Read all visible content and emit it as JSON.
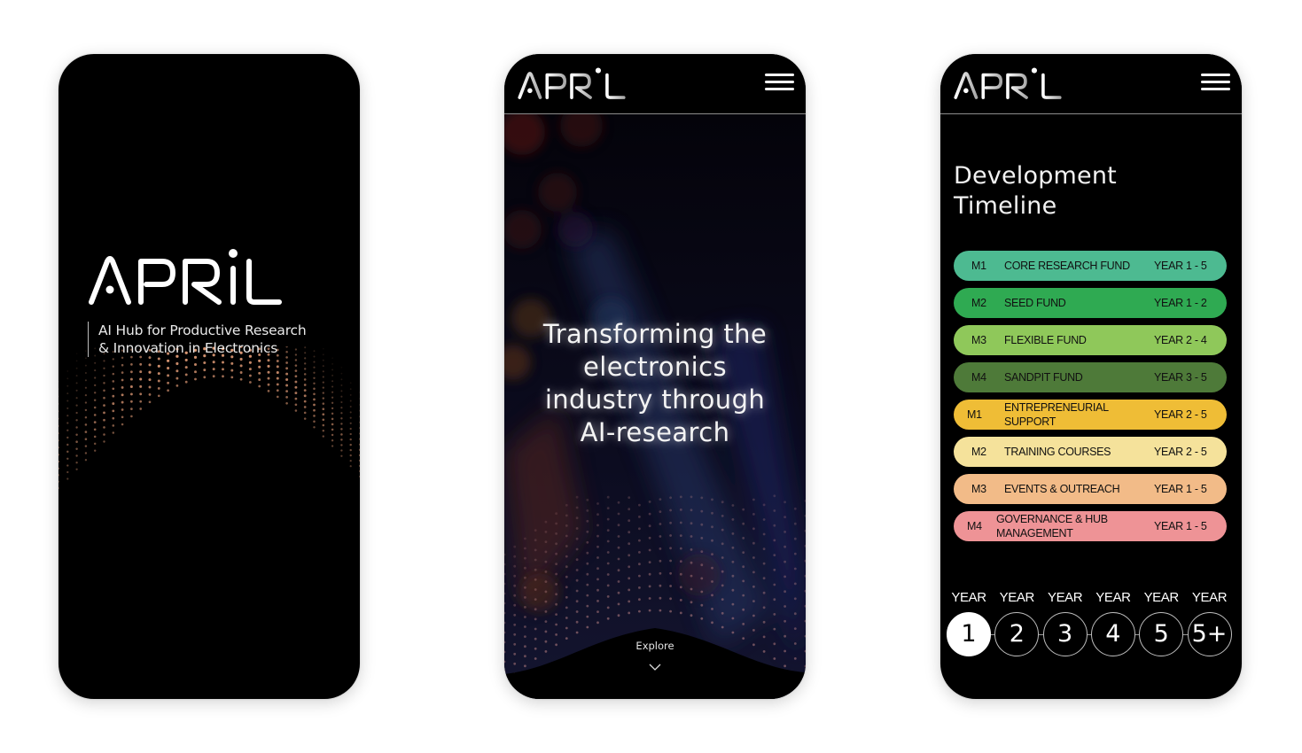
{
  "brand": {
    "logo_text": "APRIL",
    "tagline_lines": [
      "AI Hub for Productive Research",
      "& Innovation in Electronics"
    ]
  },
  "hero": {
    "title_lines": [
      "Transforming the",
      "electronics",
      "industry through",
      "AI-research"
    ],
    "explore_label": "Explore"
  },
  "timeline": {
    "title_lines": [
      "Development",
      "Timeline"
    ],
    "items": [
      {
        "code": "M1",
        "name_lines": [
          "CORE RESEARCH FUND"
        ],
        "years": "YEAR 1 - 5",
        "color": "#4dba91"
      },
      {
        "code": "M2",
        "name_lines": [
          "SEED FUND"
        ],
        "years": "YEAR 1 - 2",
        "color": "#2faa52"
      },
      {
        "code": "M3",
        "name_lines": [
          "FLEXIBLE FUND"
        ],
        "years": "YEAR 2 - 4",
        "color": "#8fc85a"
      },
      {
        "code": "M4",
        "name_lines": [
          "SANDPIT FUND"
        ],
        "years": "YEAR 3 - 5",
        "color": "#4e7a39"
      },
      {
        "code": "M1",
        "name_lines": [
          "ENTREPRENEURIAL",
          "SUPPORT"
        ],
        "years": "YEAR 2 - 5",
        "color": "#efbd36"
      },
      {
        "code": "M2",
        "name_lines": [
          "TRAINING COURSES"
        ],
        "years": "YEAR 2 - 5",
        "color": "#f5e29b"
      },
      {
        "code": "M3",
        "name_lines": [
          "EVENTS & OUTREACH"
        ],
        "years": "YEAR 1 - 5",
        "color": "#f2bb88"
      },
      {
        "code": "M4",
        "name_lines": [
          "GOVERNANCE & HUB",
          "MANAGEMENT"
        ],
        "years": "YEAR 1 - 5",
        "color": "#ee9396"
      }
    ],
    "year_label": "YEAR",
    "year_steps": [
      "1",
      "2",
      "3",
      "4",
      "5",
      "5+"
    ],
    "active_year": "1"
  }
}
